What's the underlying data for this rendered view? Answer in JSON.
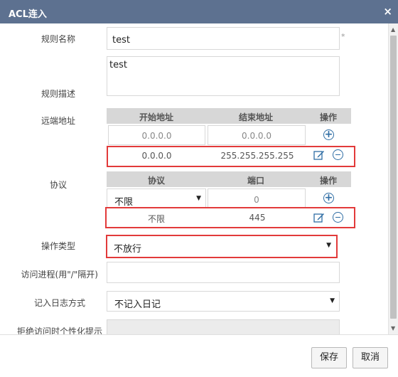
{
  "dialog": {
    "title": "ACL连入",
    "close": "×"
  },
  "labels": {
    "rule_name": "规则名称",
    "rule_desc": "规则描述",
    "remote_address": "远端地址",
    "protocol": "协议",
    "action_type": "操作类型",
    "access_process": "访问进程(用\"/\"隔开)",
    "log_mode": "记入日志方式",
    "deny_prompt": "拒绝访问时个性化提示"
  },
  "rule_name_value": "test",
  "required_mark": "*",
  "rule_desc_value": "test",
  "address_table": {
    "headers": [
      "开始地址",
      "结束地址",
      "操作"
    ],
    "input_start": "0.0.0.0",
    "input_end": "0.0.0.0",
    "rows": [
      {
        "start": "0.0.0.0",
        "end": "255.255.255.255"
      }
    ]
  },
  "protocol_table": {
    "headers": [
      "协议",
      "端口",
      "操作"
    ],
    "input_protocol": "不限",
    "input_port": "0",
    "rows": [
      {
        "protocol": "不限",
        "port": "445"
      }
    ]
  },
  "action_type_value": "不放行",
  "access_process_value": "",
  "log_mode_value": "不记入日记",
  "deny_prompt_value": "",
  "buttons": {
    "save": "保存",
    "cancel": "取消"
  },
  "colors": {
    "titlebar": "#5d7190",
    "highlight": "#e23a3a",
    "icon": "#2e6da4"
  }
}
